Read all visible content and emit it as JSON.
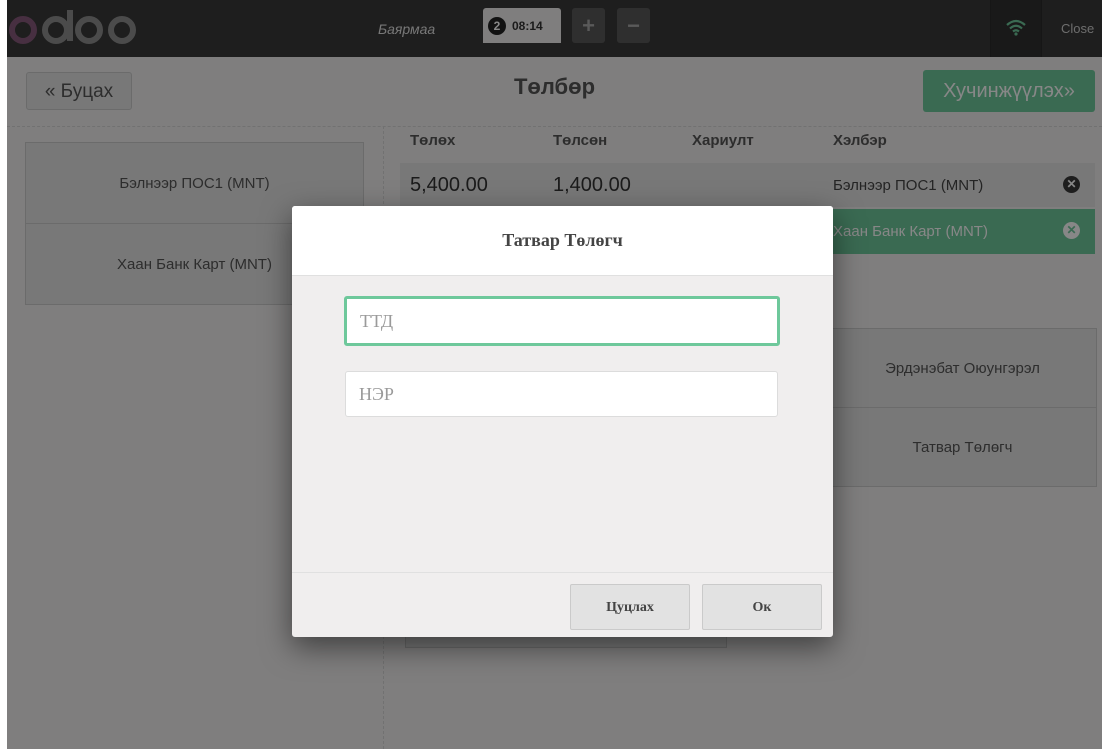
{
  "topbar": {
    "username": "Баярмаа",
    "order_number": "2",
    "order_time": "08:14",
    "plus_label": "+",
    "minus_label": "−",
    "close_label": "Close",
    "wifi_icon": "wifi-icon",
    "accent": "#6ec89b"
  },
  "payment": {
    "back_label": "« Буцах",
    "title": "Төлбөр",
    "validate_label": "Хучинжүүлэх»",
    "methods": [
      {
        "label": "Бэлнээр ПОС1 (MNT)"
      },
      {
        "label": "Хаан Банк Карт (MNT)"
      }
    ],
    "headers": {
      "due": "Төлөх",
      "tendered": "Төлсөн",
      "change": "Хариулт",
      "method": "Хэлбэр"
    },
    "lines": [
      {
        "due": "5,400.00",
        "tendered": "1,400.00",
        "method": "Бэлнээр ПОС1 (MNT)"
      },
      {
        "method": "Хаан Банк Карт (MNT)"
      }
    ],
    "customer_label": "Эрдэнэбат Оюунгэрэл",
    "taxpayer_label": "Татвар Төлөгч"
  },
  "modal": {
    "title": "Татвар Төлөгч",
    "tin_placeholder": "ТТД",
    "name_placeholder": "НЭР",
    "cancel_label": "Цуцлах",
    "ok_label": "Ок"
  }
}
